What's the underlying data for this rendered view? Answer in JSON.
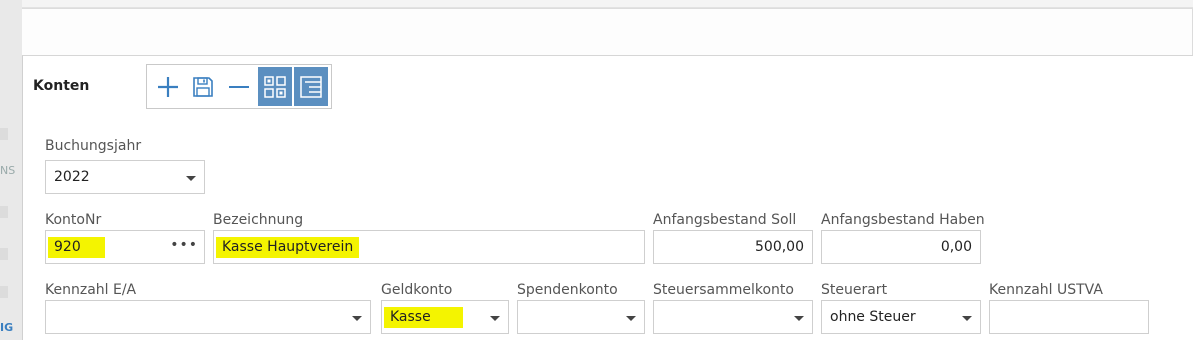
{
  "section": {
    "title": "Konten"
  },
  "toolbar": {
    "add_icon": "plus-icon",
    "save_icon": "floppy-disk-icon",
    "remove_icon": "minus-icon",
    "grid_view_icon": "grid-view-icon",
    "list_view_icon": "list-view-icon"
  },
  "form": {
    "buchungsjahr": {
      "label": "Buchungsjahr",
      "value": "2022"
    },
    "kontonr": {
      "label": "KontoNr",
      "value": "920",
      "menu": "•••"
    },
    "bezeichnung": {
      "label": "Bezeichnung",
      "value": "Kasse Hauptverein"
    },
    "anfangsbestand_soll": {
      "label": "Anfangsbestand Soll",
      "value": "500,00"
    },
    "anfangsbestand_haben": {
      "label": "Anfangsbestand Haben",
      "value": "0,00"
    },
    "kennzahl_ea": {
      "label": "Kennzahl E/A",
      "value": ""
    },
    "geldkonto": {
      "label": "Geldkonto",
      "value": "Kasse"
    },
    "spendenkonto": {
      "label": "Spendenkonto",
      "value": ""
    },
    "steuersammelkonto": {
      "label": "Steuersammelkonto",
      "value": ""
    },
    "steuerart": {
      "label": "Steuerart",
      "value": "ohne Steuer"
    },
    "kennzahl_ustva": {
      "label": "Kennzahl USTVA",
      "value": ""
    }
  },
  "background": {
    "fragment_1": "NS",
    "fragment_2": "IG"
  },
  "colors": {
    "accent": "#5b8fc0",
    "highlight": "#f4f400"
  }
}
